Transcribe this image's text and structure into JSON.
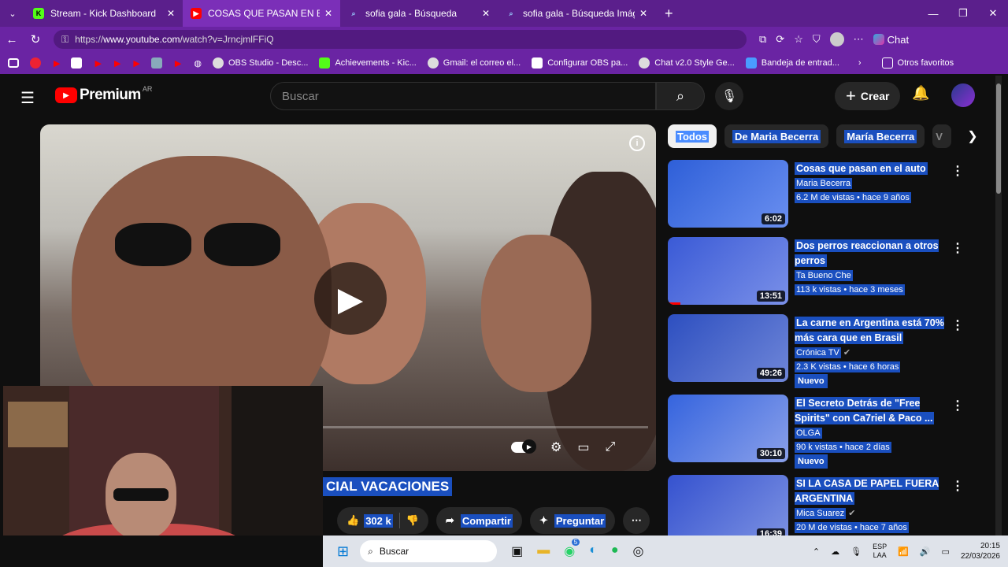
{
  "tabs": [
    {
      "title": "Stream - Kick Dashboard",
      "icon": "kick-icon",
      "active": false
    },
    {
      "title": "COSAS QUE PASAN EN EL AUTO #",
      "icon": "youtube-icon",
      "active": true
    },
    {
      "title": "sofia gala - Búsqueda",
      "icon": "search-icon",
      "active": false
    },
    {
      "title": "sofia gala - Búsqueda Imágenes",
      "icon": "search-icon",
      "active": false
    }
  ],
  "address": {
    "prefix": "https://",
    "host": "www.youtube.com",
    "path": "/watch?v=JrncjmlFFiQ"
  },
  "edge_chat": "Chat",
  "bookmarks": [
    {
      "label": "OBS Studio - Desc...",
      "color": "#ddd"
    },
    {
      "label": "Achievements - Kic...",
      "color": "#53fc18"
    },
    {
      "label": "Gmail: el correo el...",
      "color": "#ddd"
    },
    {
      "label": "Configurar OBS pa...",
      "color": "#fff"
    },
    {
      "label": "Chat v2.0 Style Ge...",
      "color": "#ddd"
    },
    {
      "label": "Bandeja de entrad...",
      "color": "#4a9cff"
    }
  ],
  "bookmarks_other": "Otros favoritos",
  "youtube": {
    "logo": "Premium",
    "region": "AR",
    "search_placeholder": "Buscar",
    "create": "Crear",
    "video_title": "CIAL VACACIONES",
    "likes": "302 k",
    "share": "Compartir",
    "ask": "Preguntar",
    "chips": [
      "Todos",
      "De Maria Becerra",
      "María Becerra",
      "V"
    ],
    "recommendations": [
      {
        "title": "Cosas que pasan en el auto",
        "channel": "Maria Becerra",
        "stats": "6.2 M de vistas • hace 9 años",
        "duration": "6:02",
        "new": false,
        "verified": false,
        "thumb": "#2e5fd8"
      },
      {
        "title": "Dos perros reaccionan a otros perros",
        "channel": "Ta Bueno Che",
        "stats": "113 k vistas • hace 3 meses",
        "duration": "13:51",
        "new": false,
        "verified": false,
        "thumb": "#3a5ad6"
      },
      {
        "title": "La carne en Argentina está 70% más cara que en Brasil",
        "channel": "Crónica TV",
        "stats": "2.3 K vistas • hace 6 horas",
        "duration": "49:26",
        "new": true,
        "verified": true,
        "thumb": "#2d4fc0"
      },
      {
        "title": "El Secreto Detrás de \"Free Spirits\" con Ca7riel & Paco ...",
        "channel": "OLGA",
        "stats": "90 k vistas • hace 2 días",
        "duration": "30:10",
        "new": true,
        "verified": false,
        "thumb": "#3564de"
      },
      {
        "title": "SI LA CASA DE PAPEL FUERA ARGENTINA",
        "channel": "Mica Suarez",
        "stats": "20 M de vistas • hace 7 años",
        "duration": "16:39",
        "new": false,
        "verified": true,
        "thumb": "#3552cf"
      }
    ],
    "new_label": "Nuevo"
  },
  "taskbar": {
    "search": "Buscar",
    "lang1": "ESP",
    "lang2": "LAA",
    "time": "20:15",
    "date": "22/03/2026",
    "badge": "5"
  }
}
